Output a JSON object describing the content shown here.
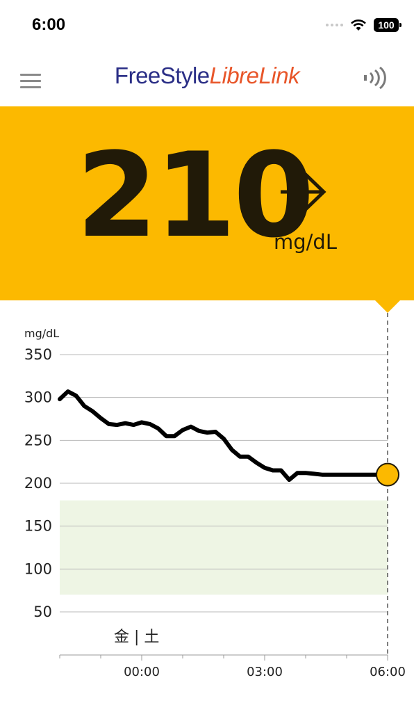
{
  "status_bar": {
    "time": "6:00",
    "battery": "100",
    "icons": [
      "signal-dots-icon",
      "wifi-icon",
      "battery-icon"
    ]
  },
  "header": {
    "logo_part1": "FreeStyle",
    "logo_part2": "LibreLink",
    "menu_icon": "hamburger-menu-icon",
    "scan_icon": "nfc-scan-icon"
  },
  "reading": {
    "value": "210",
    "unit": "mg/dL",
    "trend": "arrow-right-icon",
    "panel_color": "#fcb900"
  },
  "chart_data": {
    "type": "line",
    "ylabel": "mg/dL",
    "ylim": [
      30,
      350
    ],
    "yticks": [
      350,
      300,
      250,
      200,
      150,
      100,
      50
    ],
    "xticks": [
      "00:00",
      "03:00",
      "06:00"
    ],
    "day_label": "金 | 土",
    "target_range": [
      70,
      180
    ],
    "target_color": "#eef5e4",
    "line_color": "#000000",
    "current_marker_color": "#fcb900",
    "x": [
      -2.0,
      -1.8,
      -1.6,
      -1.4,
      -1.2,
      -1.0,
      -0.8,
      -0.6,
      -0.4,
      -0.2,
      0.0,
      0.2,
      0.4,
      0.6,
      0.8,
      1.0,
      1.2,
      1.4,
      1.6,
      1.8,
      2.0,
      2.2,
      2.4,
      2.6,
      2.8,
      3.0,
      3.2,
      3.4,
      3.6,
      3.8,
      4.0,
      4.2,
      4.4,
      4.6,
      4.8,
      5.0,
      5.2,
      5.4,
      5.6,
      5.8,
      6.0
    ],
    "values": [
      298,
      307,
      302,
      290,
      284,
      276,
      269,
      268,
      270,
      268,
      271,
      269,
      264,
      255,
      255,
      262,
      266,
      261,
      259,
      260,
      252,
      239,
      231,
      231,
      224,
      218,
      215,
      215,
      204,
      212,
      212,
      211,
      210,
      210,
      210,
      210,
      210,
      210,
      210,
      210,
      210
    ],
    "current": {
      "x": 6.0,
      "value": 210
    }
  }
}
